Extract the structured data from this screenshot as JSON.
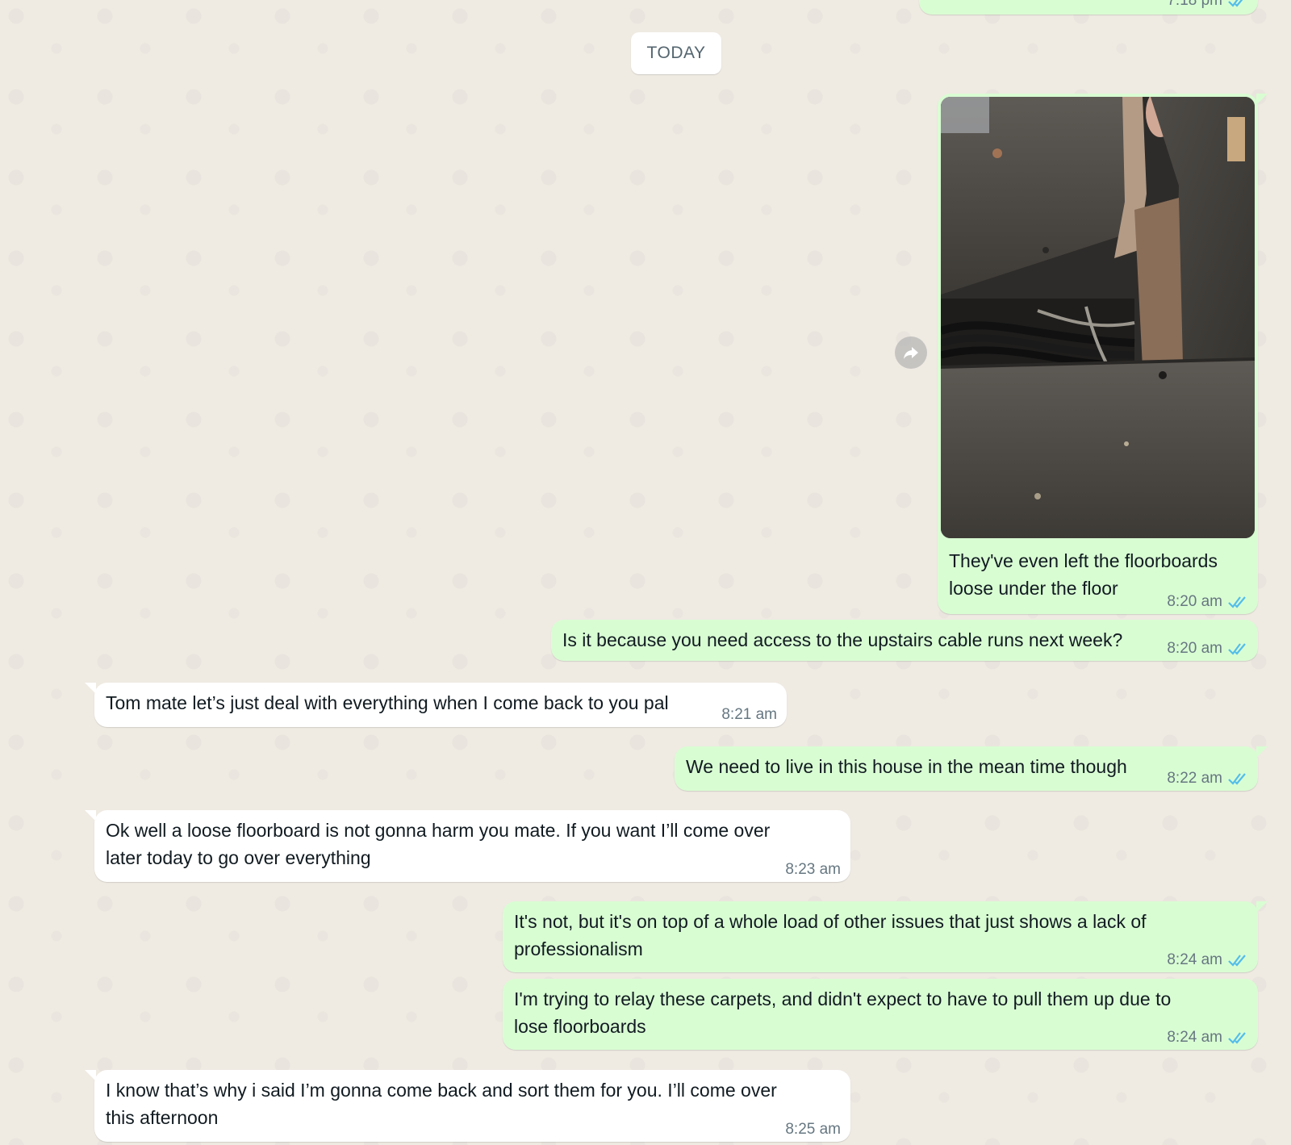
{
  "date_divider": "TODAY",
  "messages": [
    {
      "id": "m0",
      "direction": "out",
      "text": "",
      "time": "7:18 pm",
      "status": "read"
    },
    {
      "id": "m1",
      "direction": "out",
      "has_image": true,
      "image_icon": "photo-floorboards",
      "text": "They've even left the floorboards\nloose under the floor",
      "time": "8:20 am",
      "status": "read"
    },
    {
      "id": "m2",
      "direction": "out",
      "text": "Is it because you need access to the upstairs cable runs next week?",
      "time": "8:20 am",
      "status": "read"
    },
    {
      "id": "m3",
      "direction": "in",
      "text": "Tom mate let’s just deal with everything when I come back to you pal",
      "time": "8:21 am"
    },
    {
      "id": "m4",
      "direction": "out",
      "text": "We need to live in this house in the mean time though",
      "time": "8:22 am",
      "status": "read"
    },
    {
      "id": "m5",
      "direction": "in",
      "text": "Ok well a loose floorboard is not gonna harm you mate. If you want I’ll come over\nlater today to go over everything",
      "time": "8:23 am"
    },
    {
      "id": "m6",
      "direction": "out",
      "text": "It's not, but it's on top of a whole load of other issues that just shows a lack of\nprofessionalism",
      "time": "8:24 am",
      "status": "read"
    },
    {
      "id": "m7",
      "direction": "out",
      "text": "I'm trying to relay these carpets, and didn't expect to have to pull them up due to\nlose floorboards",
      "time": "8:24 am",
      "status": "read"
    },
    {
      "id": "m8",
      "direction": "in",
      "text": "I know that’s why i said I’m gonna come back and sort them for you. I’ll come over\nthis afternoon",
      "time": "8:25 am"
    }
  ],
  "icons": {
    "forward": "forward-arrow-icon",
    "read_receipt": "double-check-icon"
  },
  "colors": {
    "background": "#efeae2",
    "outgoing_bubble": "#d9fdd3",
    "incoming_bubble": "#ffffff",
    "read_tick": "#53bdeb",
    "meta_text": "#667781"
  }
}
